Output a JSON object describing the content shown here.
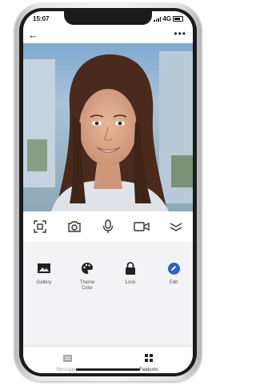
{
  "status_bar": {
    "time": "15:07",
    "network": "4G"
  },
  "top_bar": {
    "back_icon": "arrow-left-icon",
    "more_icon": "more-dots-icon"
  },
  "photo": {
    "description_icon": "portrait-photo"
  },
  "action_bar": {
    "items": [
      {
        "icon": "scan-face-icon"
      },
      {
        "icon": "camera-icon"
      },
      {
        "icon": "microphone-icon"
      },
      {
        "icon": "video-camera-icon"
      },
      {
        "icon": "collapse-chevron-icon"
      }
    ]
  },
  "features": [
    {
      "label": "Gallery",
      "icon": "gallery-icon"
    },
    {
      "label": "Theme\nColor",
      "icon": "palette-icon"
    },
    {
      "label": "Lock",
      "icon": "lock-icon"
    },
    {
      "label": "Edit",
      "icon": "pencil-icon",
      "accent": "#2b63c9"
    }
  ],
  "bottom_nav": [
    {
      "label": "Messages",
      "icon": "messages-icon",
      "active": false
    },
    {
      "label": "Features",
      "icon": "grid-icon",
      "active": true
    }
  ],
  "colors": {
    "accent": "#2b63c9",
    "inactive": "#a6a6a6",
    "active": "#222222"
  }
}
